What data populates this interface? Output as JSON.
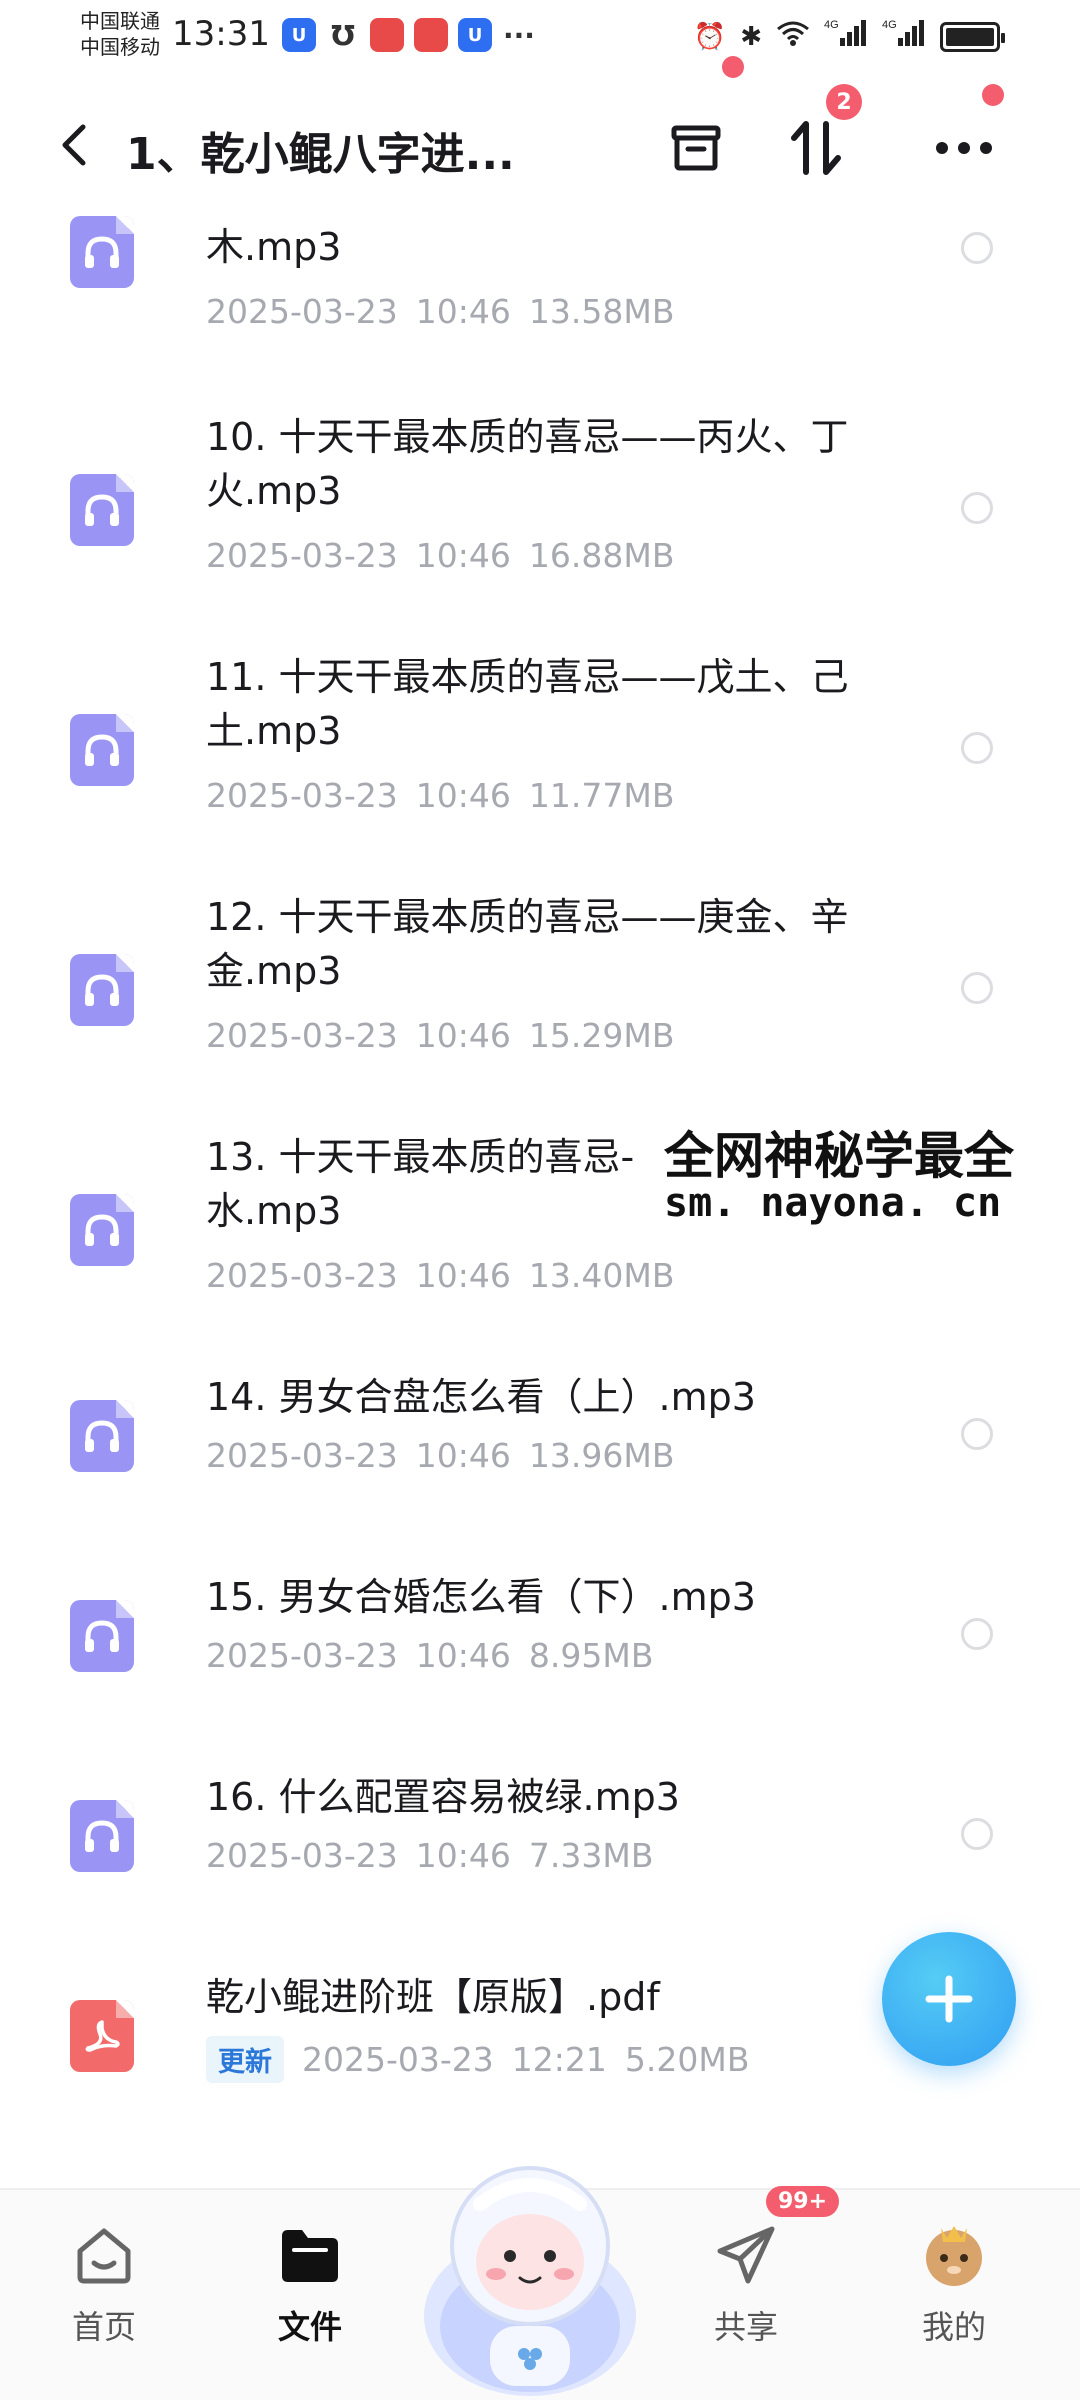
{
  "status_bar": {
    "carrier1": "中国联通",
    "carrier2": "中国移动",
    "time": "13:31",
    "network1": "4G",
    "network2": "4G"
  },
  "top_bar": {
    "title": "1、乾小鲲八字进...",
    "sort_badge": "2"
  },
  "files": [
    {
      "name": "木.mp3",
      "date": "2025-03-23",
      "time": "10:46",
      "size": "13.58MB",
      "type": "audio"
    },
    {
      "name": "10. 十天干最本质的喜忌——丙火、丁火.mp3",
      "date": "2025-03-23",
      "time": "10:46",
      "size": "16.88MB",
      "type": "audio"
    },
    {
      "name": "11. 十天干最本质的喜忌——戊土、己土.mp3",
      "date": "2025-03-23",
      "time": "10:46",
      "size": "11.77MB",
      "type": "audio"
    },
    {
      "name": "12. 十天干最本质的喜忌——庚金、辛金.mp3",
      "date": "2025-03-23",
      "time": "10:46",
      "size": "15.29MB",
      "type": "audio"
    },
    {
      "name": "13. 十天干最本质的喜忌-",
      "name_line2": "水.mp3",
      "date": "2025-03-23",
      "time": "10:46",
      "size": "13.40MB",
      "type": "audio"
    },
    {
      "name": "14. 男女合盘怎么看（上）.mp3",
      "date": "2025-03-23",
      "time": "10:46",
      "size": "13.96MB",
      "type": "audio"
    },
    {
      "name": "15. 男女合婚怎么看（下）.mp3",
      "date": "2025-03-23",
      "time": "10:46",
      "size": "8.95MB",
      "type": "audio"
    },
    {
      "name": "16. 什么配置容易被绿.mp3",
      "date": "2025-03-23",
      "time": "10:46",
      "size": "7.33MB",
      "type": "audio"
    },
    {
      "name": "乾小鲲进阶班【原版】.pdf",
      "tag": "更新",
      "date": "2025-03-23",
      "time": "12:21",
      "size": "5.20MB",
      "type": "pdf"
    }
  ],
  "watermark": {
    "title": "全网神秘学最全",
    "url": "sm. nayona. cn"
  },
  "bottom_nav": {
    "home": "首页",
    "files": "文件",
    "share": "共享",
    "share_badge": "99+",
    "me": "我的"
  },
  "colors": {
    "audio_icon": "#9a95f5",
    "pdf_icon": "#f26a6a",
    "fab": "#2f9df2",
    "badge": "#f35d6e",
    "meta_text": "#a7a9b0"
  }
}
